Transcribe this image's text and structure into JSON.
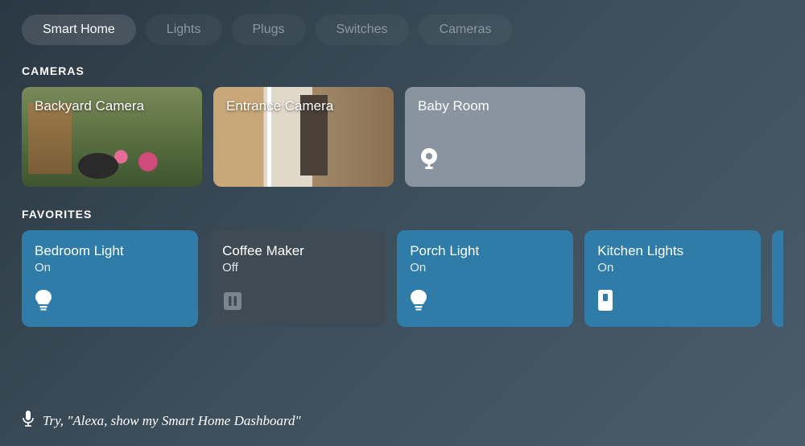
{
  "tabs": [
    {
      "label": "Smart Home",
      "active": true
    },
    {
      "label": "Lights",
      "active": false
    },
    {
      "label": "Plugs",
      "active": false
    },
    {
      "label": "Switches",
      "active": false
    },
    {
      "label": "Cameras",
      "active": false
    }
  ],
  "sections": {
    "cameras": {
      "title": "CAMERAS",
      "items": [
        {
          "name": "Backyard Camera",
          "type": "live"
        },
        {
          "name": "Entrance Camera",
          "type": "live"
        },
        {
          "name": "Baby Room",
          "type": "offline",
          "icon": "camera-icon"
        }
      ]
    },
    "favorites": {
      "title": "FAVORITES",
      "items": [
        {
          "name": "Bedroom Light",
          "status": "On",
          "icon": "bulb-icon",
          "on": true
        },
        {
          "name": "Coffee Maker",
          "status": "Off",
          "icon": "plug-icon",
          "on": false
        },
        {
          "name": "Porch Light",
          "status": "On",
          "icon": "bulb-icon",
          "on": true
        },
        {
          "name": "Kitchen Lights",
          "status": "On",
          "icon": "switch-icon",
          "on": true
        }
      ]
    }
  },
  "hint": {
    "icon": "mic-icon",
    "text": "Try, \"Alexa, show my Smart Home Dashboard\""
  },
  "colors": {
    "on": "#2f7ca8",
    "off": "#3e4b55"
  }
}
